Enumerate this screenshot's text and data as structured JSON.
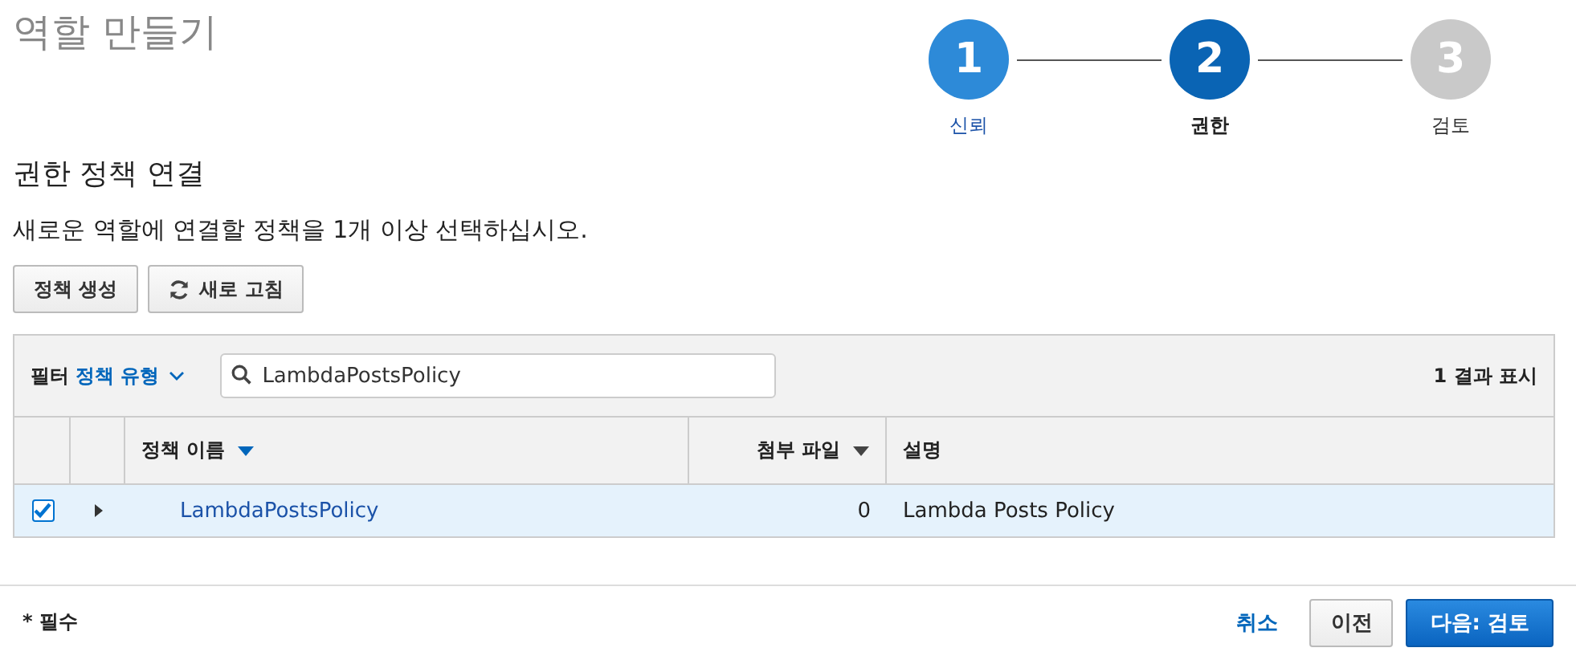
{
  "page_title": "역할 만들기",
  "steps": [
    {
      "number": "1",
      "label": "신뢰",
      "kind": "done"
    },
    {
      "number": "2",
      "label": "권한",
      "kind": "current"
    },
    {
      "number": "3",
      "label": "검토",
      "kind": "pending"
    }
  ],
  "section_title": "권한 정책 연결",
  "description": "새로운 역할에 연결할 정책을 1개 이상 선택하십시오.",
  "toolbar": {
    "create_button": "정책 생성",
    "refresh_button": "새로 고침"
  },
  "filter": {
    "label": "필터",
    "type_dropdown": "정책 유형",
    "search_value": "LambdaPostsPolicy",
    "result_count": "1 결과 표시"
  },
  "table": {
    "columns": [
      {
        "label": "정책 이름",
        "sorted": true
      },
      {
        "label": "첨부 파일",
        "sorted": true
      },
      {
        "label": "설명",
        "sorted": false
      }
    ],
    "rows": [
      {
        "selected": true,
        "expanded": false,
        "name": "LambdaPostsPolicy",
        "attachments": "0",
        "description": "Lambda Posts Policy"
      }
    ]
  },
  "footer": {
    "required_note": "* 필수",
    "cancel": "취소",
    "previous": "이전",
    "next": "다음: 검토"
  }
}
